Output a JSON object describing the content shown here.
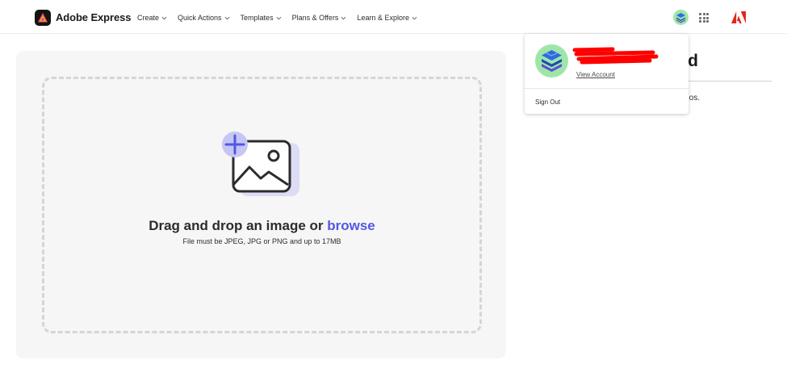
{
  "header": {
    "brand": "Adobe Express",
    "nav": [
      {
        "label": "Create"
      },
      {
        "label": "Quick Actions"
      },
      {
        "label": "Templates"
      },
      {
        "label": "Plans & Offers"
      },
      {
        "label": "Learn & Explore"
      }
    ],
    "icons": {
      "logo": "adobe-express-logo",
      "apps": "app-grid-icon",
      "adobe": "adobe-logo-icon",
      "avatar": "user-avatar"
    }
  },
  "upload": {
    "drop_text": "Drag and drop an image or ",
    "browse_label": "browse",
    "file_hint": "File must be JPEG, JPG or PNG and up to 17MB",
    "accent": "#5258e4"
  },
  "background_content": {
    "heading_fragment": "d",
    "text_fragment": "os."
  },
  "account_menu": {
    "view_account": "View Account",
    "sign_out": "Sign Out"
  }
}
